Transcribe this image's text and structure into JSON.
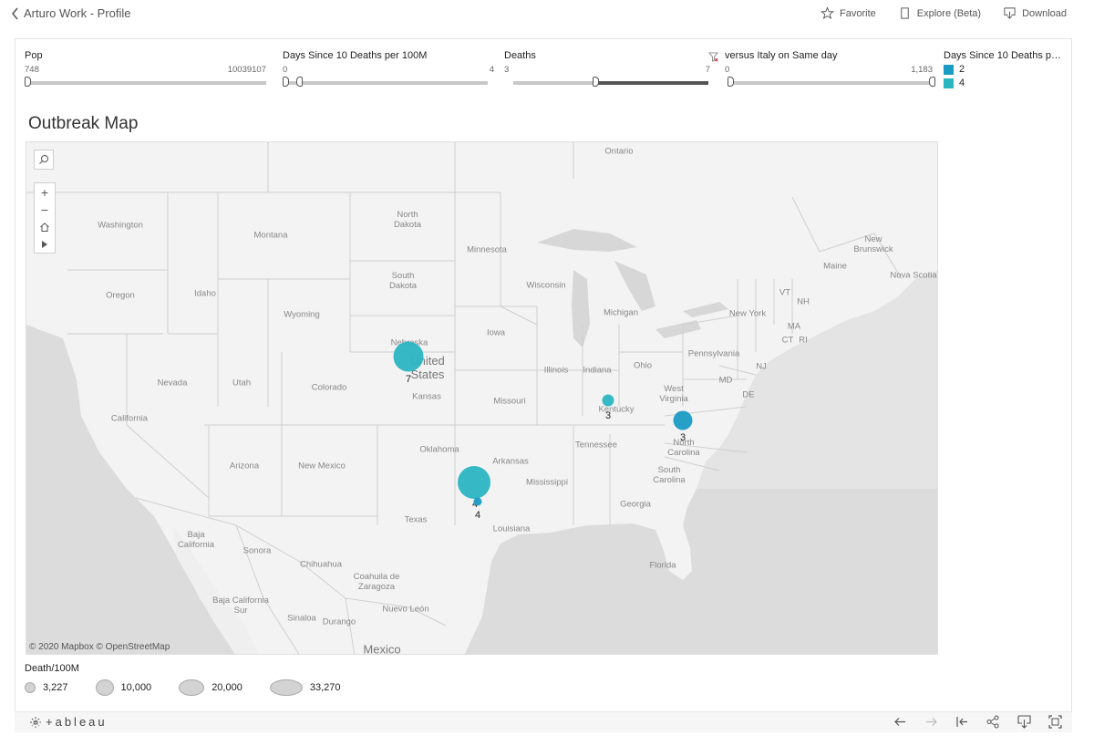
{
  "header": {
    "back_label": "Arturo Work - Profile",
    "favorite_label": "Favorite",
    "explore_label": "Explore (Beta)",
    "download_label": "Download"
  },
  "filters": [
    {
      "title": "Pop",
      "min": "748",
      "max": "10039107"
    },
    {
      "title": "Days Since 10 Deaths per 100M",
      "min": "0",
      "max": "4"
    },
    {
      "title": "Deaths",
      "min": "3",
      "max": "7"
    },
    {
      "title": "versus Italy on Same day",
      "min": "0",
      "max": "1,183"
    }
  ],
  "color_legend": {
    "title": "Days Since 10 Deaths per...",
    "items": [
      {
        "label": "2",
        "color": "#1a9bc3"
      },
      {
        "label": "4",
        "color": "#2bb5c1"
      }
    ]
  },
  "map": {
    "title": "Outbreak Map",
    "attribution": "© 2020 Mapbox © OpenStreetMap",
    "labels": {
      "ontario": "Ontario",
      "washington": "Washington",
      "montana": "Montana",
      "north_dakota": "North\nDakota",
      "minnesota": "Minnesota",
      "oregon": "Oregon",
      "idaho": "Idaho",
      "wyoming": "Wyoming",
      "south_dakota": "South\nDakota",
      "wisconsin": "Wisconsin",
      "michigan": "Michigan",
      "new_york": "New York",
      "new_brunswick": "New\nBrunswick",
      "maine": "Maine",
      "nova_scotia": "Nova Scotia",
      "vt": "VT",
      "nh": "NH",
      "ma": "MA",
      "ct": "CT",
      "ri": "RI",
      "nj": "NJ",
      "md": "MD",
      "de": "DE",
      "nebraska": "Nebraska",
      "iowa": "Iowa",
      "united_states": "United\nStates",
      "illinois": "Illinois",
      "indiana": "Indiana",
      "ohio": "Ohio",
      "pennsylvania": "Pennsylvania",
      "nevada": "Nevada",
      "utah": "Utah",
      "colorado": "Colorado",
      "kansas": "Kansas",
      "missouri": "Missouri",
      "kentucky": "Kentucky",
      "west_virginia": "West\nVirginia",
      "virginia": "Virginia",
      "california": "California",
      "north_carolina": "North\nCarolina",
      "tennessee": "Tennessee",
      "oklahoma": "Oklahoma",
      "arkansas": "Arkansas",
      "south_carolina": "South\nCarolina",
      "arizona": "Arizona",
      "new_mexico": "New Mexico",
      "mississippi": "Mississippi",
      "georgia": "Georgia",
      "texas": "Texas",
      "louisiana": "Louisiana",
      "baja_california": "Baja\nCalifornia",
      "sonora": "Sonora",
      "chihuahua": "Chihuahua",
      "coahuila": "Coahuila de\nZaragoza",
      "florida": "Florida",
      "nuevo_leon": "Nuevo León",
      "baja_california_sur": "Baja California\nSur",
      "sinaloa": "Sinaloa",
      "durango": "Durango",
      "mexico": "Mexico"
    },
    "bubbles": [
      {
        "name": "nebraska",
        "label": "7",
        "color": "#2bb5c1"
      },
      {
        "name": "kentucky",
        "label": "3",
        "color": "#2bb5c1"
      },
      {
        "name": "north-carolina",
        "label": "3",
        "color": "#1a9bc3"
      },
      {
        "name": "texas-large",
        "label": "4",
        "color": "#2bb5c1"
      },
      {
        "name": "texas-small",
        "label": "4",
        "color": "#1a9bc3"
      }
    ]
  },
  "size_legend": {
    "title": "Death/100M",
    "items": [
      "3,227",
      "10,000",
      "20,000",
      "33,270"
    ]
  },
  "footer": {
    "logo_text": "+ableau"
  }
}
